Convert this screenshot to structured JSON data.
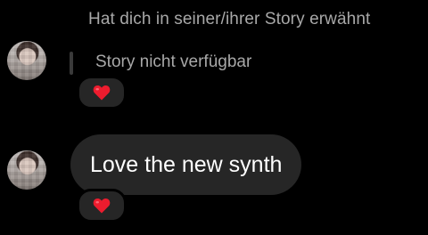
{
  "mention": {
    "header": "Hat dich in seiner/ihrer Story erwähnt",
    "story_status": "Story nicht verfügbar",
    "reaction_icon": "red-heart-icon",
    "reaction_color": "#ed1c2e"
  },
  "message": {
    "text": "Love the new synth",
    "reaction_icon": "red-heart-icon",
    "reaction_color": "#ed1c2e"
  },
  "colors": {
    "background": "#000000",
    "bubble": "#262626",
    "secondary_text": "#a8a8a8"
  }
}
